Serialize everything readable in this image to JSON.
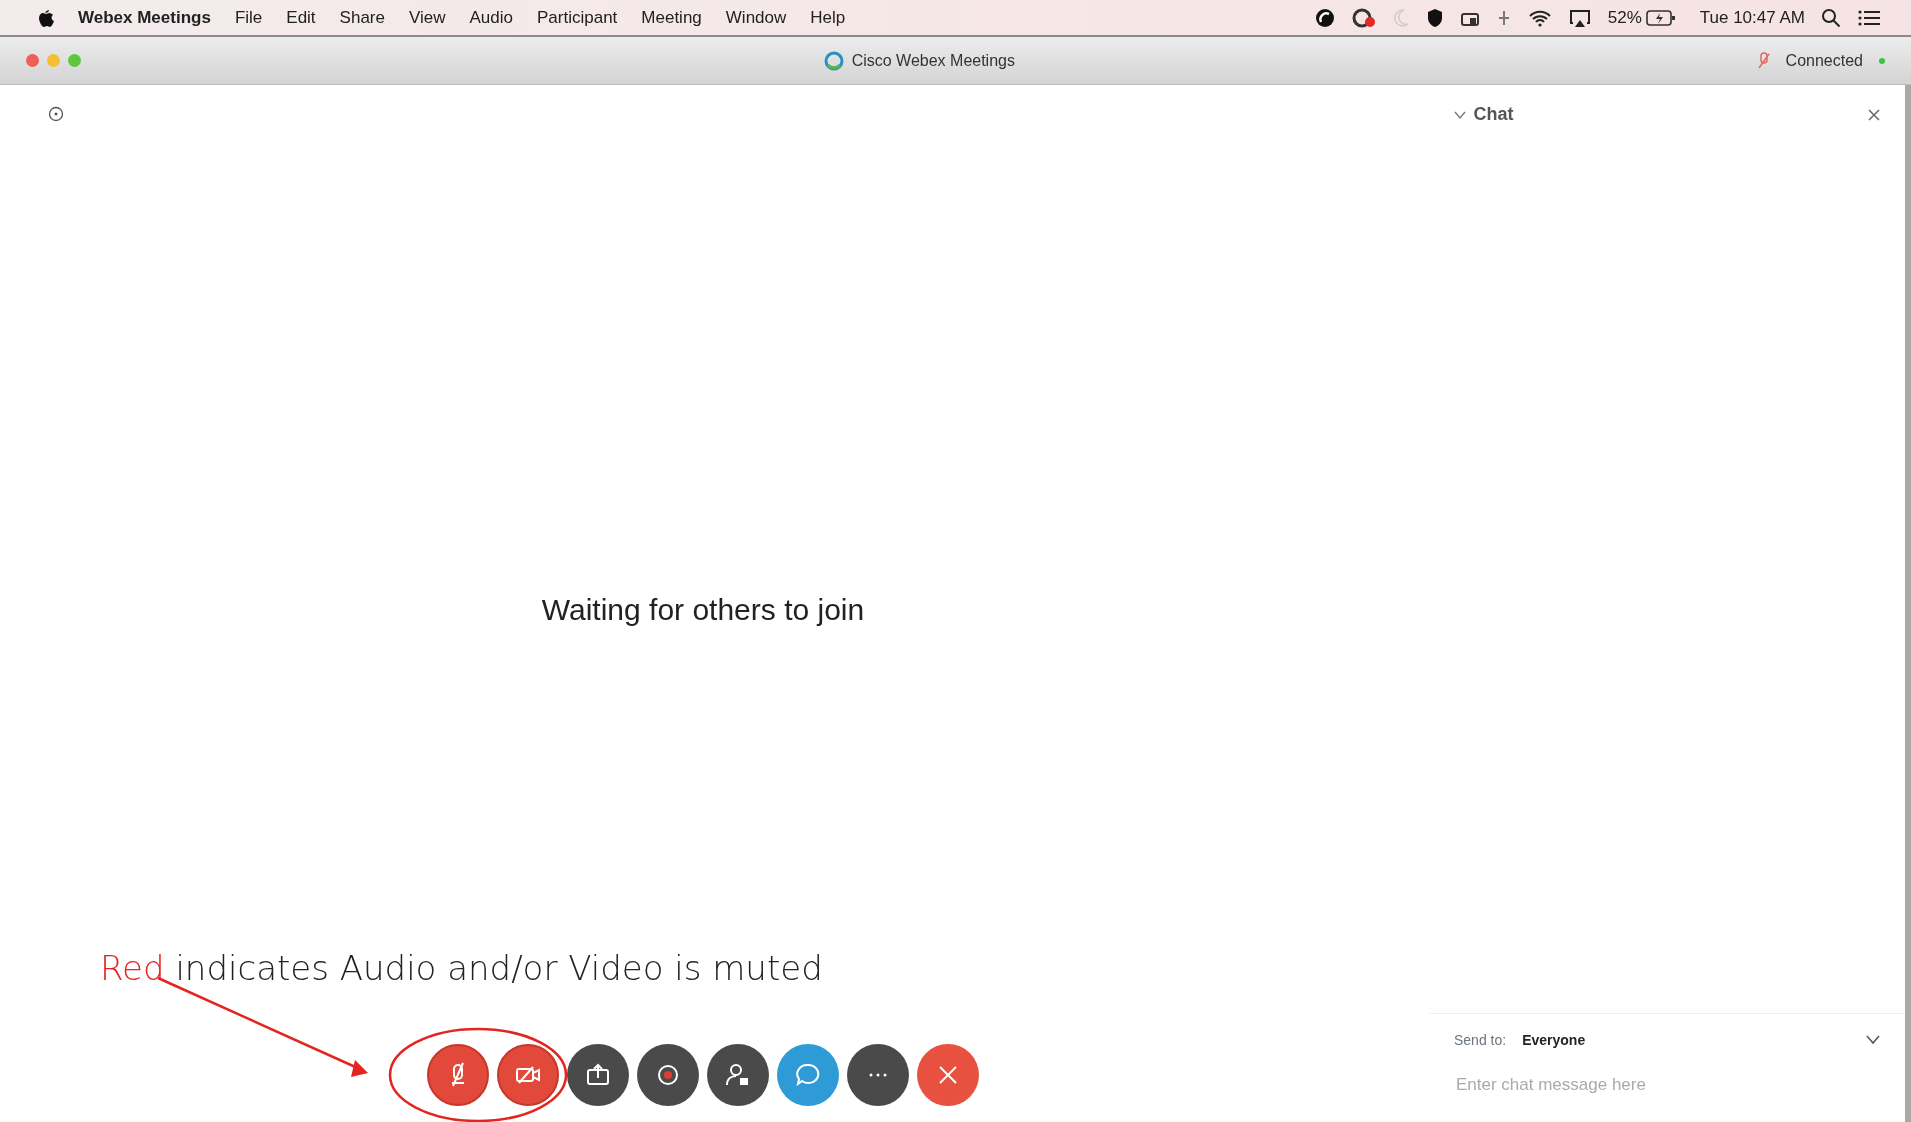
{
  "menu_bar": {
    "app_name": "Webex Meetings",
    "items": [
      "File",
      "Edit",
      "Share",
      "View",
      "Audio",
      "Participant",
      "Meeting",
      "Window",
      "Help"
    ],
    "battery": "52%",
    "clock": "Tue 10:47 AM"
  },
  "window": {
    "title": "Cisco Webex Meetings",
    "connection": "Connected"
  },
  "stage": {
    "message": "Waiting for others to join"
  },
  "annotation": {
    "highlight": "Red",
    "text": "indicates Audio and/or Video is muted"
  },
  "toolbar": [
    {
      "kind": "audio",
      "muted": true,
      "active": false
    },
    {
      "kind": "video",
      "muted": true,
      "active": false
    },
    {
      "kind": "share",
      "muted": false,
      "active": false
    },
    {
      "kind": "record",
      "muted": false,
      "active": false
    },
    {
      "kind": "participants",
      "muted": false,
      "active": false
    },
    {
      "kind": "chat",
      "muted": false,
      "active": true
    },
    {
      "kind": "more",
      "muted": false,
      "active": false
    },
    {
      "kind": "end",
      "muted": false,
      "active": false
    }
  ],
  "chat": {
    "title": "Chat",
    "send_to_label": "Send to:",
    "send_to": "Everyone",
    "placeholder": "Enter chat message here"
  }
}
